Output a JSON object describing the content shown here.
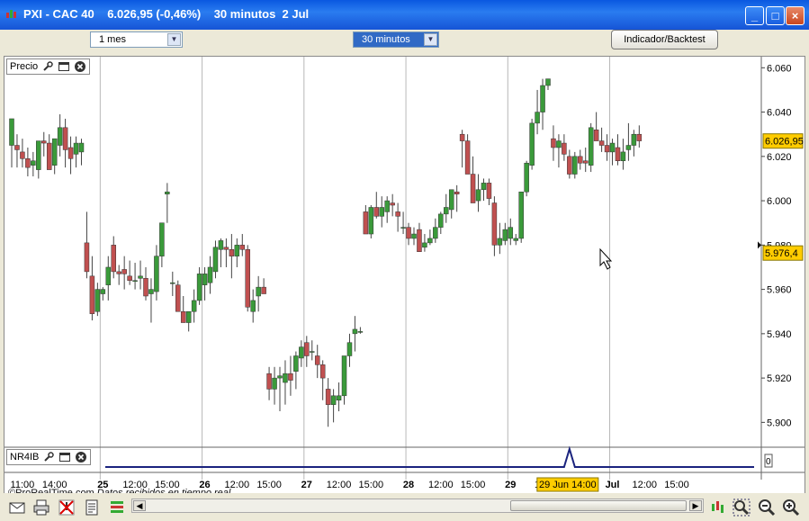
{
  "window": {
    "title": "PXI - CAC 40    6.026,95 (-0,46%)    30 minutos  2 Jul",
    "min_label": "_",
    "max_label": "□",
    "close_label": "×"
  },
  "toolbar": {
    "period_value": "1 mes",
    "interval_value": "30 minutos",
    "indicator_button": "Indicador/Backtest"
  },
  "panes": {
    "price_label": "Precio",
    "indicator_label": "NR4IB",
    "indicator_axis_value": "0"
  },
  "watermark": {
    "source": "©ProRealTime.com",
    "status": "Datos recibidos en tiempo real"
  },
  "colors": {
    "up": "#3a9a3a",
    "down": "#c05050",
    "wick": "#444444",
    "gridline": "#b8b8b8",
    "price_tag": "#ffcc00",
    "indicator_line": "#1a237e",
    "titlebar": "#0a58e0"
  },
  "icons": [
    "wrench-icon",
    "window-icon",
    "close-circle-icon",
    "mail-icon",
    "print-icon",
    "no-alert-icon",
    "notes-icon",
    "list-icon",
    "candles-icon",
    "zoom-box-icon",
    "zoom-out-icon",
    "zoom-in-icon"
  ],
  "chart_data": {
    "type": "candlestick",
    "y_axis": {
      "range": [
        5890,
        6065
      ],
      "ticks": [
        "6.060",
        "6.040",
        "6.020",
        "6.000",
        "5.980",
        "5.960",
        "5.940",
        "5.920",
        "5.900"
      ],
      "tick_values": [
        6060,
        6040,
        6020,
        6000,
        5980,
        5960,
        5940,
        5920,
        5900
      ]
    },
    "last_price_tag": "6.026,95",
    "last_price_value": 6026.95,
    "cursor_price_tag": "5.976,4",
    "cursor_price_value": 5976.4,
    "x_axis": {
      "ticks": [
        {
          "label": "11:00",
          "bold": false,
          "bar": 2
        },
        {
          "label": "14:00",
          "bold": false,
          "bar": 8
        },
        {
          "label": "25",
          "bold": true,
          "bar": 17
        },
        {
          "label": "12:00",
          "bold": false,
          "bar": 23
        },
        {
          "label": "15:00",
          "bold": false,
          "bar": 29
        },
        {
          "label": "26",
          "bold": true,
          "bar": 36
        },
        {
          "label": "12:00",
          "bold": false,
          "bar": 42
        },
        {
          "label": "15:00",
          "bold": false,
          "bar": 48
        },
        {
          "label": "27",
          "bold": true,
          "bar": 55
        },
        {
          "label": "12:00",
          "bold": false,
          "bar": 61
        },
        {
          "label": "15:00",
          "bold": false,
          "bar": 67
        },
        {
          "label": "28",
          "bold": true,
          "bar": 74
        },
        {
          "label": "12:00",
          "bold": false,
          "bar": 80
        },
        {
          "label": "15:00",
          "bold": false,
          "bar": 86
        },
        {
          "label": "29",
          "bold": true,
          "bar": 93
        },
        {
          "label": "1",
          "bold": false,
          "bar": 98
        },
        {
          "label": "Jul",
          "bold": true,
          "bar": 112
        },
        {
          "label": "12:00",
          "bold": false,
          "bar": 118
        },
        {
          "label": "15:00",
          "bold": false,
          "bar": 124
        }
      ],
      "cursor_label": "29 Jun 14:00",
      "cursor_bar": 104,
      "day_separators": [
        17,
        36,
        55,
        74,
        93,
        112
      ]
    },
    "candles": [
      {
        "o": 6025,
        "h": 6037,
        "l": 6015,
        "c": 6037
      },
      {
        "o": 6025,
        "h": 6030,
        "l": 6015,
        "c": 6023
      },
      {
        "o": 6022,
        "h": 6028,
        "l": 6015,
        "c": 6019
      },
      {
        "o": 6019,
        "h": 6024,
        "l": 6011,
        "c": 6015
      },
      {
        "o": 6016,
        "h": 6022,
        "l": 6011,
        "c": 6018
      },
      {
        "o": 6014,
        "h": 6020,
        "l": 6010,
        "c": 6027
      },
      {
        "o": 6027,
        "h": 6031,
        "l": 6020,
        "c": 6026
      },
      {
        "o": 6026,
        "h": 6030,
        "l": 6015,
        "c": 6014
      },
      {
        "o": 6016,
        "h": 6025,
        "l": 6012,
        "c": 6028
      },
      {
        "o": 6025,
        "h": 6039,
        "l": 6020,
        "c": 6033
      },
      {
        "o": 6033,
        "h": 6037,
        "l": 6015,
        "c": 6023
      },
      {
        "o": 6024,
        "h": 6029,
        "l": 6012,
        "c": 6019
      },
      {
        "o": 6021,
        "h": 6029,
        "l": 6015,
        "c": 6026
      },
      {
        "o": 6022,
        "h": 6028,
        "l": 6016,
        "c": 6026
      },
      {
        "o": 5981,
        "h": 5995,
        "l": 5965,
        "c": 5968
      },
      {
        "o": 5966,
        "h": 5975,
        "l": 5946,
        "c": 5949
      },
      {
        "o": 5950,
        "h": 5963,
        "l": 5948,
        "c": 5960
      },
      {
        "o": 5958,
        "h": 5961,
        "l": 5955,
        "c": 5960
      },
      {
        "o": 5962,
        "h": 5975,
        "l": 5955,
        "c": 5970
      },
      {
        "o": 5980,
        "h": 5984,
        "l": 5965,
        "c": 5968
      },
      {
        "o": 5968,
        "h": 5971,
        "l": 5962,
        "c": 5967
      },
      {
        "o": 5969,
        "h": 5975,
        "l": 5960,
        "c": 5967
      },
      {
        "o": 5966,
        "h": 5973,
        "l": 5962,
        "c": 5964
      },
      {
        "o": 5964,
        "h": 5972,
        "l": 5960,
        "c": 5964
      },
      {
        "o": 5965,
        "h": 5973,
        "l": 5960,
        "c": 5966
      },
      {
        "o": 5965,
        "h": 5970,
        "l": 5955,
        "c": 5957
      },
      {
        "o": 5958,
        "h": 5965,
        "l": 5945,
        "c": 5960
      },
      {
        "o": 5959,
        "h": 5980,
        "l": 5955,
        "c": 5975
      },
      {
        "o": 5975,
        "h": 5989,
        "l": 5970,
        "c": 5990
      },
      {
        "o": 6003,
        "h": 6008,
        "l": 5990,
        "c": 6004
      },
      {
        "o": 5963,
        "h": 5968,
        "l": 5957,
        "c": 5963
      },
      {
        "o": 5962,
        "h": 5964,
        "l": 5950,
        "c": 5950
      },
      {
        "o": 5950,
        "h": 5957,
        "l": 5945,
        "c": 5945
      },
      {
        "o": 5945,
        "h": 5950,
        "l": 5941,
        "c": 5950
      },
      {
        "o": 5950,
        "h": 5960,
        "l": 5945,
        "c": 5955
      },
      {
        "o": 5955,
        "h": 5970,
        "l": 5953,
        "c": 5967
      },
      {
        "o": 5962,
        "h": 5970,
        "l": 5955,
        "c": 5967
      },
      {
        "o": 5963,
        "h": 5975,
        "l": 5958,
        "c": 5970
      },
      {
        "o": 5968,
        "h": 5982,
        "l": 5965,
        "c": 5979
      },
      {
        "o": 5978,
        "h": 5983,
        "l": 5970,
        "c": 5982
      },
      {
        "o": 5979,
        "h": 5983,
        "l": 5970,
        "c": 5978
      },
      {
        "o": 5978,
        "h": 5985,
        "l": 5965,
        "c": 5975
      },
      {
        "o": 5975,
        "h": 5983,
        "l": 5970,
        "c": 5980
      },
      {
        "o": 5980,
        "h": 5985,
        "l": 5975,
        "c": 5978
      },
      {
        "o": 5978,
        "h": 5980,
        "l": 5950,
        "c": 5952
      },
      {
        "o": 5950,
        "h": 5960,
        "l": 5945,
        "c": 5955
      },
      {
        "o": 5957,
        "h": 5966,
        "l": 5950,
        "c": 5961
      },
      {
        "o": 5961,
        "h": 5965,
        "l": 5958,
        "c": 5958
      },
      {
        "o": 5922,
        "h": 5925,
        "l": 5910,
        "c": 5915
      },
      {
        "o": 5915,
        "h": 5925,
        "l": 5908,
        "c": 5920
      },
      {
        "o": 5920,
        "h": 5925,
        "l": 5905,
        "c": 5921
      },
      {
        "o": 5918,
        "h": 5928,
        "l": 5908,
        "c": 5922
      },
      {
        "o": 5922,
        "h": 5930,
        "l": 5912,
        "c": 5919
      },
      {
        "o": 5923,
        "h": 5932,
        "l": 5915,
        "c": 5930
      },
      {
        "o": 5929,
        "h": 5937,
        "l": 5925,
        "c": 5934
      },
      {
        "o": 5936,
        "h": 5939,
        "l": 5925,
        "c": 5930
      },
      {
        "o": 5932,
        "h": 5937,
        "l": 5928,
        "c": 5932
      },
      {
        "o": 5930,
        "h": 5935,
        "l": 5920,
        "c": 5926
      },
      {
        "o": 5926,
        "h": 5928,
        "l": 5910,
        "c": 5920
      },
      {
        "o": 5915,
        "h": 5920,
        "l": 5898,
        "c": 5908
      },
      {
        "o": 5908,
        "h": 5915,
        "l": 5900,
        "c": 5912
      },
      {
        "o": 5910,
        "h": 5918,
        "l": 5905,
        "c": 5912
      },
      {
        "o": 5912,
        "h": 5925,
        "l": 5908,
        "c": 5930
      },
      {
        "o": 5930,
        "h": 5940,
        "l": 5925,
        "c": 5936
      },
      {
        "o": 5940,
        "h": 5948,
        "l": 5932,
        "c": 5942
      },
      {
        "o": 5941,
        "h": 5943,
        "l": 5940,
        "c": 5941
      },
      {
        "o": 5995,
        "h": 5998,
        "l": 5985,
        "c": 5985
      },
      {
        "o": 5985,
        "h": 5998,
        "l": 5983,
        "c": 5997
      },
      {
        "o": 5997,
        "h": 6004,
        "l": 5992,
        "c": 5993
      },
      {
        "o": 5993,
        "h": 6002,
        "l": 5988,
        "c": 5997
      },
      {
        "o": 5995,
        "h": 6002,
        "l": 5990,
        "c": 6000
      },
      {
        "o": 5999,
        "h": 6003,
        "l": 5993,
        "c": 5998
      },
      {
        "o": 5995,
        "h": 5999,
        "l": 5986,
        "c": 5993
      },
      {
        "o": 5988,
        "h": 5995,
        "l": 5985,
        "c": 5988
      },
      {
        "o": 5988,
        "h": 5990,
        "l": 5980,
        "c": 5983
      },
      {
        "o": 5983,
        "h": 5988,
        "l": 5980,
        "c": 5985
      },
      {
        "o": 5987,
        "h": 5990,
        "l": 5978,
        "c": 5977
      },
      {
        "o": 5979,
        "h": 5985,
        "l": 5977,
        "c": 5981
      },
      {
        "o": 5981,
        "h": 5987,
        "l": 5980,
        "c": 5983
      },
      {
        "o": 5983,
        "h": 5992,
        "l": 5981,
        "c": 5988
      },
      {
        "o": 5988,
        "h": 5995,
        "l": 5985,
        "c": 5994
      },
      {
        "o": 5994,
        "h": 6003,
        "l": 5990,
        "c": 5997
      },
      {
        "o": 5996,
        "h": 6000,
        "l": 5992,
        "c": 6005
      },
      {
        "o": 6004,
        "h": 6007,
        "l": 5995,
        "c": 6003
      },
      {
        "o": 6030,
        "h": 6032,
        "l": 6015,
        "c": 6027
      },
      {
        "o": 6027,
        "h": 6030,
        "l": 6015,
        "c": 6012
      },
      {
        "o": 6012,
        "h": 6020,
        "l": 6000,
        "c": 5999
      },
      {
        "o": 6000,
        "h": 6012,
        "l": 5995,
        "c": 6005
      },
      {
        "o": 6005,
        "h": 6010,
        "l": 6000,
        "c": 6008
      },
      {
        "o": 6008,
        "h": 6010,
        "l": 5998,
        "c": 6001
      },
      {
        "o": 5999,
        "h": 6002,
        "l": 5975,
        "c": 5980
      },
      {
        "o": 5980,
        "h": 5990,
        "l": 5976,
        "c": 5983
      },
      {
        "o": 5982,
        "h": 5990,
        "l": 5980,
        "c": 5987
      },
      {
        "o": 5983,
        "h": 5992,
        "l": 5980,
        "c": 5988
      },
      {
        "o": 5982,
        "h": 5985,
        "l": 5980,
        "c": 5983
      },
      {
        "o": 5983,
        "h": 6003,
        "l": 5981,
        "c": 6004
      },
      {
        "o": 6004,
        "h": 6018,
        "l": 6002,
        "c": 6017
      },
      {
        "o": 6016,
        "h": 6037,
        "l": 6014,
        "c": 6035
      },
      {
        "o": 6035,
        "h": 6050,
        "l": 6030,
        "c": 6040
      },
      {
        "o": 6040,
        "h": 6055,
        "l": 6032,
        "c": 6052
      },
      {
        "o": 6052,
        "h": 6055,
        "l": 6050,
        "c": 6055
      },
      {
        "o": 6028,
        "h": 6034,
        "l": 6018,
        "c": 6024
      },
      {
        "o": 6024,
        "h": 6030,
        "l": 6015,
        "c": 6027
      },
      {
        "o": 6026,
        "h": 6030,
        "l": 6018,
        "c": 6021
      },
      {
        "o": 6020,
        "h": 6023,
        "l": 6010,
        "c": 6012
      },
      {
        "o": 6012,
        "h": 6022,
        "l": 6010,
        "c": 6020
      },
      {
        "o": 6020,
        "h": 6023,
        "l": 6014,
        "c": 6017
      },
      {
        "o": 6018,
        "h": 6024,
        "l": 6013,
        "c": 6017
      },
      {
        "o": 6016,
        "h": 6035,
        "l": 6013,
        "c": 6033
      },
      {
        "o": 6032,
        "h": 6040,
        "l": 6027,
        "c": 6027
      },
      {
        "o": 6027,
        "h": 6033,
        "l": 6022,
        "c": 6025
      },
      {
        "o": 6025,
        "h": 6030,
        "l": 6018,
        "c": 6022
      },
      {
        "o": 6022,
        "h": 6028,
        "l": 6016,
        "c": 6026
      },
      {
        "o": 6024,
        "h": 6030,
        "l": 6016,
        "c": 6018
      },
      {
        "o": 6018,
        "h": 6028,
        "l": 6014,
        "c": 6022
      },
      {
        "o": 6023,
        "h": 6035,
        "l": 6018,
        "c": 6025
      },
      {
        "o": 6025,
        "h": 6032,
        "l": 6020,
        "c": 6030
      },
      {
        "o": 6030,
        "h": 6034,
        "l": 6024,
        "c": 6027
      }
    ],
    "indicator": {
      "name": "NR4IB",
      "values_note": "flat at 0 with single spike near 29 Jun 14:00",
      "spike_bar": 104
    }
  }
}
